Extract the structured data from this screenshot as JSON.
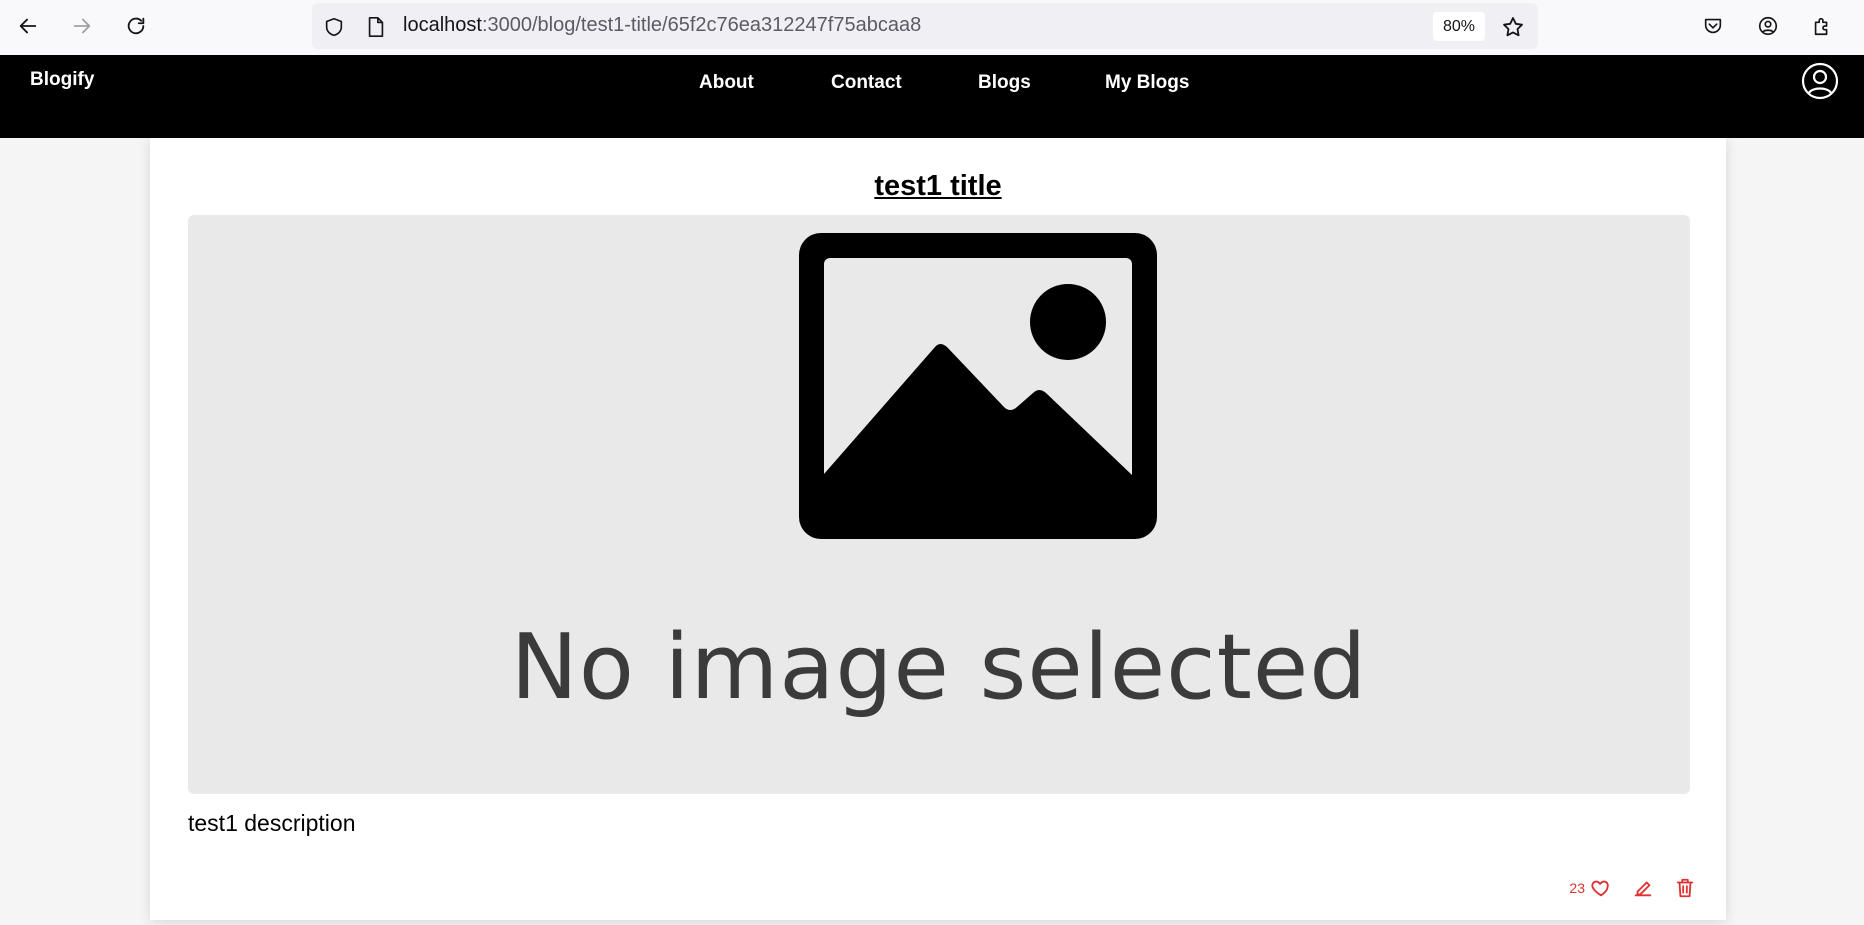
{
  "browser": {
    "url_host": "localhost",
    "url_path": ":3000/blog/test1-title/65f2c76ea312247f75abcaa8",
    "zoom": "80%"
  },
  "site": {
    "brand": "Blogify",
    "nav": [
      {
        "label": "About"
      },
      {
        "label": "Contact"
      },
      {
        "label": "Blogs"
      },
      {
        "label": "My Blogs"
      }
    ]
  },
  "post": {
    "title": "test1 title",
    "image_caption": "No image selected",
    "description": "test1 description",
    "likes": "23"
  },
  "colors": {
    "accent": "#e03232",
    "nav_bg": "#000000"
  }
}
